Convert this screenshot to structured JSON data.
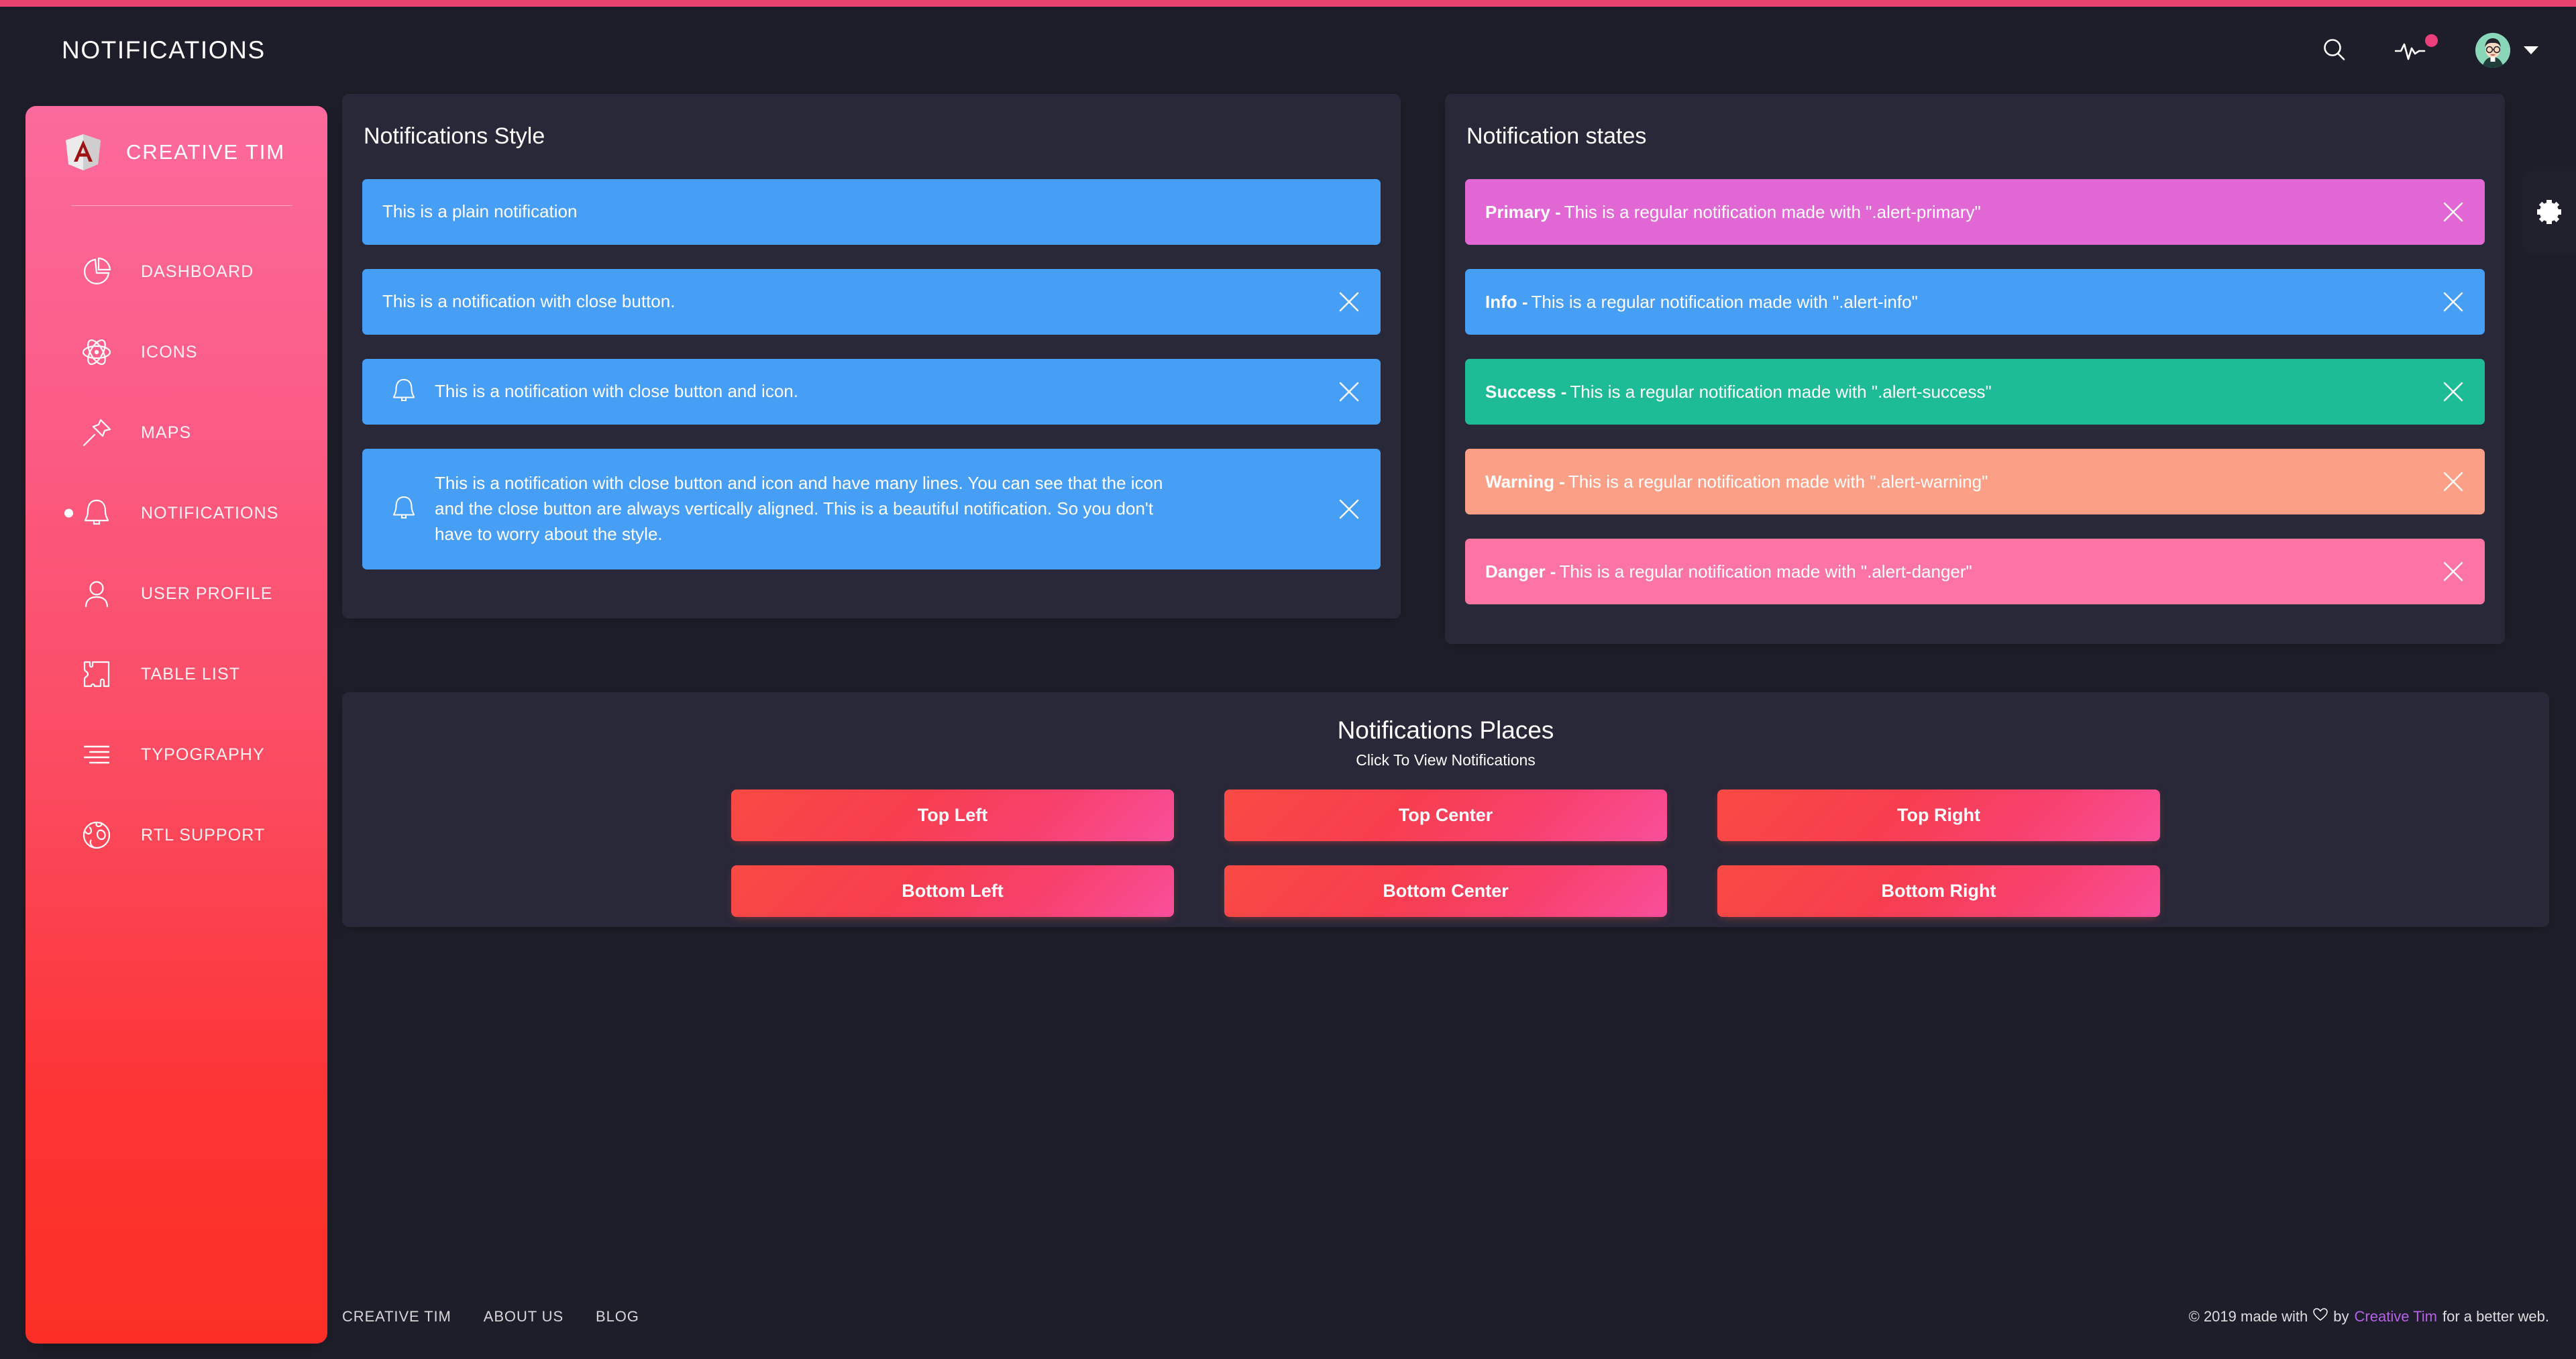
{
  "theme": {
    "page_bg": "#1e1e2a",
    "card_bg": "#282838",
    "accent_bar": "#e8436f",
    "sidebar_gradient_from": "#fb6a9c",
    "sidebar_gradient_to": "#fb2f25",
    "info_blue": "#479ef5",
    "primary_pink": "#e168d4",
    "success_green": "#1dbb96",
    "warning_orange": "#fb9f86",
    "danger_pink": "#fb74a4",
    "brand_link": "#b561e8",
    "badge_pink": "#ec407a"
  },
  "navbar": {
    "title": "NOTIFICATIONS",
    "search_icon": "search-icon",
    "activity_icon": "activity-pulse-icon",
    "avatar_icon": "user-avatar",
    "caret_icon": "chevron-down-icon"
  },
  "sidebar": {
    "brand": "CREATIVE TIM",
    "logo_icon": "angular-logo-icon",
    "items": [
      {
        "label": "DASHBOARD",
        "icon": "pie-chart-icon",
        "active": false
      },
      {
        "label": "ICONS",
        "icon": "atom-icon",
        "active": false
      },
      {
        "label": "MAPS",
        "icon": "pin-icon",
        "active": false
      },
      {
        "label": "NOTIFICATIONS",
        "icon": "bell-icon",
        "active": true
      },
      {
        "label": "USER PROFILE",
        "icon": "user-icon",
        "active": false
      },
      {
        "label": "TABLE LIST",
        "icon": "puzzle-icon",
        "active": false
      },
      {
        "label": "TYPOGRAPHY",
        "icon": "text-lines-icon",
        "active": false
      },
      {
        "label": "RTL SUPPORT",
        "icon": "globe-icon",
        "active": false
      }
    ]
  },
  "notifications_style": {
    "title": "Notifications Style",
    "alerts": [
      {
        "text": "This is a plain notification",
        "has_close": false,
        "has_icon": false,
        "multiline": false
      },
      {
        "text": "This is a notification with close button.",
        "has_close": true,
        "has_icon": false,
        "multiline": false
      },
      {
        "text": "This is a notification with close button and icon.",
        "has_close": true,
        "has_icon": true,
        "multiline": false
      },
      {
        "text": "This is a notification with close button and icon and have many lines. You can see that the icon and the close button are always vertically aligned. This is a beautiful notification. So you don't have to worry about the style.",
        "has_close": true,
        "has_icon": true,
        "multiline": true
      }
    ]
  },
  "notification_states": {
    "title": "Notification states",
    "alerts": [
      {
        "label": "Primary -",
        "text": "This is a regular notification made with \".alert-primary\"",
        "color": "#e168d4"
      },
      {
        "label": "Info -",
        "text": "This is a regular notification made with \".alert-info\"",
        "color": "#479ef5"
      },
      {
        "label": "Success -",
        "text": "This is a regular notification made with \".alert-success\"",
        "color": "#1dbb96"
      },
      {
        "label": "Warning -",
        "text": "This is a regular notification made with \".alert-warning\"",
        "color": "#fb9f86"
      },
      {
        "label": "Danger -",
        "text": "This is a regular notification made with \".alert-danger\"",
        "color": "#fb74a4"
      }
    ]
  },
  "notifications_places": {
    "title": "Notifications Places",
    "subtitle": "Click To View Notifications",
    "buttons": [
      "Top Left",
      "Top Center",
      "Top Right",
      "Bottom Left",
      "Bottom Center",
      "Bottom Right"
    ]
  },
  "footer": {
    "links": [
      "CREATIVE TIM",
      "ABOUT US",
      "BLOG"
    ],
    "copyright_prefix": "© 2019 made with",
    "heart_icon": "heart-icon",
    "copyright_by": "by",
    "brand": "Creative Tim",
    "copyright_suffix": "for a better web."
  },
  "settings_tab": {
    "icon": "gear-icon"
  }
}
